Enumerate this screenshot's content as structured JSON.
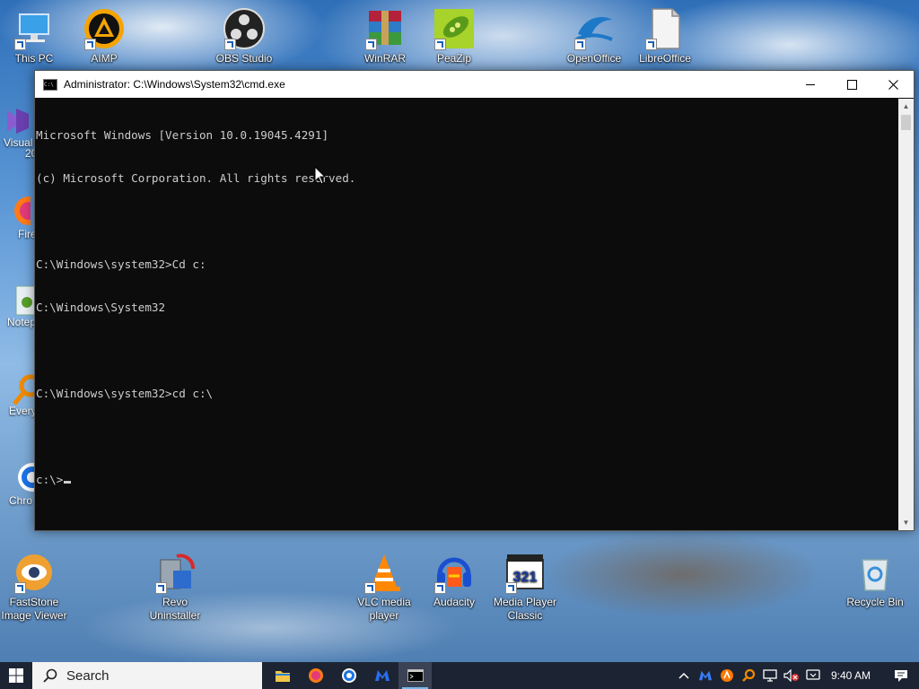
{
  "desktop": {
    "top_icons": [
      {
        "label": "This PC",
        "icon": "computer-icon"
      },
      {
        "label": "AIMP",
        "icon": "aimp-icon"
      },
      {
        "label": "OBS Studio",
        "icon": "obs-icon"
      },
      {
        "label": "WinRAR",
        "icon": "winrar-icon"
      },
      {
        "label": "PeaZip",
        "icon": "peazip-icon"
      },
      {
        "label": "OpenOffice",
        "icon": "openoffice-icon"
      },
      {
        "label": "LibreOffice",
        "icon": "libreoffice-icon"
      }
    ],
    "left_partial_icons": [
      {
        "label": "Visual",
        "extra": "20",
        "icon": "visual-studio-icon"
      },
      {
        "label": "Fire",
        "icon": "firefox-icon"
      },
      {
        "label": "Notep",
        "icon": "notepad-icon"
      },
      {
        "label": "Every",
        "icon": "everything-icon"
      },
      {
        "label": "Chro",
        "icon": "chrome-icon"
      }
    ],
    "bottom_icons": [
      {
        "label_line1": "FastStone",
        "label_line2": "Image Viewer",
        "icon": "faststone-icon"
      },
      {
        "label_line1": "Revo",
        "label_line2": "Uninstaller",
        "icon": "revo-icon"
      },
      {
        "label_line1": "VLC media",
        "label_line2": "player",
        "icon": "vlc-icon"
      },
      {
        "label_line1": "Audacity",
        "label_line2": "",
        "icon": "audacity-icon"
      },
      {
        "label_line1": "Media Player",
        "label_line2": "Classic",
        "icon": "mpc-icon"
      },
      {
        "label_line1": "Recycle Bin",
        "label_line2": "",
        "icon": "recycle-bin-icon"
      }
    ]
  },
  "cmd_window": {
    "title": "Administrator: C:\\Windows\\System32\\cmd.exe",
    "icon_text": "C:\\",
    "lines": [
      "Microsoft Windows [Version 10.0.19045.4291]",
      "(c) Microsoft Corporation. All rights reserved.",
      "",
      "C:\\Windows\\system32>Cd c:",
      "C:\\Windows\\System32",
      "",
      "C:\\Windows\\system32>cd c:\\",
      "",
      "c:\\>"
    ],
    "colors": {
      "background": "#0c0c0c",
      "text": "#cccccc"
    }
  },
  "taskbar": {
    "search_label": "Search",
    "apps": [
      "file-explorer-icon",
      "firefox-icon",
      "chrome-icon",
      "malwarebytes-icon",
      "cmd-icon"
    ],
    "tray_icons": [
      "chevron-up-icon",
      "malwarebytes-icon",
      "avast-icon",
      "search-tool-icon",
      "network-icon",
      "volume-muted-icon",
      "display-icon"
    ],
    "time": "9:40 AM",
    "colors": {
      "background": "#1c2433",
      "accent": "#76b9ed"
    }
  }
}
